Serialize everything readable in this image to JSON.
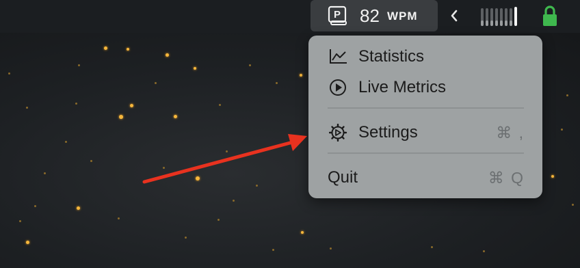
{
  "menubar": {
    "wpm_value": "82",
    "wpm_unit": "WPM",
    "app_icon_letter": "P",
    "icons": [
      "typing-app-icon",
      "chevron-left-icon",
      "level-meter-icon",
      "lock-icon"
    ],
    "level_meter_fraction": 0.15,
    "colors": {
      "bar": "#1b1e21",
      "item_highlight": "#3a3d40",
      "lock": "#3fb84e"
    }
  },
  "dropdown": {
    "items": [
      {
        "label": "Statistics",
        "icon": "line-chart-icon",
        "shortcut": ""
      },
      {
        "label": "Live Metrics",
        "icon": "play-circle-icon",
        "shortcut": ""
      },
      {
        "label": "Settings",
        "icon": "gear-icon",
        "shortcut": "⌘ ,"
      },
      {
        "label": "Quit",
        "icon": "",
        "shortcut": "⌘ Q"
      }
    ],
    "colors": {
      "background": "#9ea2a3",
      "text": "#1b1b1b",
      "shortcut": "#6c7072"
    }
  },
  "annotation": {
    "arrow_color": "#e8321f"
  }
}
